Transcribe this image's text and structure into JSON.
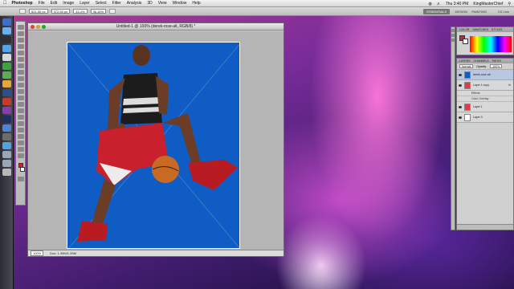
{
  "menubar": {
    "items": [
      {
        "label": "Photoshop",
        "bold": true
      },
      {
        "label": "File"
      },
      {
        "label": "Edit"
      },
      {
        "label": "Image"
      },
      {
        "label": "Layer"
      },
      {
        "label": "Select"
      },
      {
        "label": "Filter"
      },
      {
        "label": "Analysis"
      },
      {
        "label": "3D"
      },
      {
        "label": "View"
      },
      {
        "label": "Window"
      },
      {
        "label": "Help"
      }
    ],
    "clock": "Thu 3:40 PM",
    "user": "KingMasterChief"
  },
  "optbar": {
    "x": "521.50 px",
    "y": "372.50 px",
    "w": "33.4%",
    "h": "36.16%",
    "essentials": "ESSENTIALS",
    "design": "DESIGN",
    "painting": "PAINTING",
    "cslive": "CS Live"
  },
  "document": {
    "title": "Untitled-1 @ 100% (derek-rose-alt, RGB/8) *",
    "zoom": "100%",
    "doc_size": "Doc: 1.39M/1.39M"
  },
  "colorpanel": {
    "tabs": [
      "COLOR",
      "SWATCHES",
      "STYLES"
    ]
  },
  "layers": {
    "tabs": [
      "LAYERS",
      "CHANNELS",
      "PATHS"
    ],
    "blend_mode": "Normal",
    "opacity_label": "Opacity:",
    "opacity": "100%",
    "items": [
      {
        "name": "derek-rose-alt",
        "selected": true,
        "thumb": "#0f5cc5"
      },
      {
        "name": "Layer 1 copy",
        "selected": false,
        "thumb": "#e23b4a",
        "fx": true
      },
      {
        "name": "Effects",
        "effect": true
      },
      {
        "name": "Color Overlay",
        "effect": true
      },
      {
        "name": "Layer 1",
        "selected": false,
        "thumb": "#e23b4a"
      },
      {
        "name": "Layer 0",
        "selected": false,
        "thumb": "#ffffff"
      }
    ]
  }
}
